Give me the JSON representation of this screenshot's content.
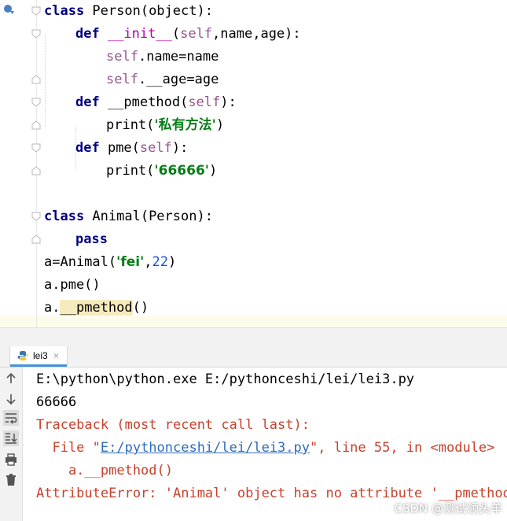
{
  "editor": {
    "lines": [
      {
        "parts": [
          {
            "t": "class",
            "c": "kw"
          },
          {
            "t": " Person(object):",
            "c": ""
          }
        ]
      },
      {
        "parts": [
          {
            "t": "def",
            "c": "kw"
          },
          {
            "t": " __init__",
            "c": "dunder"
          },
          {
            "t": "(",
            "c": ""
          },
          {
            "t": "self",
            "c": "slf"
          },
          {
            "t": ",name,age):",
            "c": ""
          }
        ]
      },
      {
        "parts": [
          {
            "t": "self",
            "c": "slf"
          },
          {
            "t": ".name=name",
            "c": ""
          }
        ]
      },
      {
        "parts": [
          {
            "t": "self",
            "c": "slf"
          },
          {
            "t": ".__age=age",
            "c": ""
          }
        ]
      },
      {
        "parts": [
          {
            "t": "def",
            "c": "kw"
          },
          {
            "t": " __pmethod(",
            "c": ""
          },
          {
            "t": "self",
            "c": "slf"
          },
          {
            "t": "):",
            "c": ""
          }
        ]
      },
      {
        "parts": [
          {
            "t": "print(",
            "c": ""
          },
          {
            "t": "'私有方法'",
            "c": "str"
          },
          {
            "t": ")",
            "c": ""
          }
        ]
      },
      {
        "parts": [
          {
            "t": "def",
            "c": "kw"
          },
          {
            "t": " pme(",
            "c": ""
          },
          {
            "t": "self",
            "c": "slf"
          },
          {
            "t": "):",
            "c": ""
          }
        ]
      },
      {
        "parts": [
          {
            "t": "print(",
            "c": ""
          },
          {
            "t": "'66666'",
            "c": "str"
          },
          {
            "t": ")",
            "c": ""
          }
        ]
      },
      {
        "parts": []
      },
      {
        "parts": [
          {
            "t": "class",
            "c": "kw"
          },
          {
            "t": " Animal(Person):",
            "c": ""
          }
        ]
      },
      {
        "parts": [
          {
            "t": "pass",
            "c": "kw"
          }
        ]
      },
      {
        "parts": [
          {
            "t": "a=Animal(",
            "c": ""
          },
          {
            "t": "'fei'",
            "c": "str"
          },
          {
            "t": ",",
            "c": ""
          },
          {
            "t": "22",
            "c": "num"
          },
          {
            "t": ")",
            "c": ""
          }
        ]
      },
      {
        "parts": [
          {
            "t": "a.pme()",
            "c": ""
          }
        ]
      },
      {
        "parts": [
          {
            "t": "a.",
            "c": ""
          },
          {
            "t": "__pmethod",
            "c": "pmeth-hl"
          },
          {
            "t": "()",
            "c": ""
          }
        ]
      }
    ]
  },
  "run_tab": {
    "label": "lei3",
    "close": "×"
  },
  "console": {
    "lines": [
      {
        "t": "E:\\python\\python.exe E:/pythonceshi/lei/lei3.py",
        "c": "gray"
      },
      {
        "t": "66666",
        "c": "gray"
      },
      {
        "t": "Traceback (most recent call last):",
        "c": "err"
      },
      {
        "t": "  File \"",
        "c": "err",
        "link": "E:/pythonceshi/lei/lei3.py",
        "rest": "\", line 55, in <module>"
      },
      {
        "t": "    a.__pmethod()",
        "c": "err"
      },
      {
        "t": "AttributeError: 'Animal' object has no attribute '__pmethod'",
        "c": "err"
      }
    ]
  },
  "watermark": "CSDN @测试领头羊",
  "icons": {
    "run-gutter": "run-debug-icon",
    "tab": "python-file-icon",
    "tools": [
      "arrow-up-icon",
      "arrow-down-icon",
      "soft-wrap-icon",
      "scroll-to-end-icon",
      "print-icon",
      "trash-icon"
    ]
  }
}
